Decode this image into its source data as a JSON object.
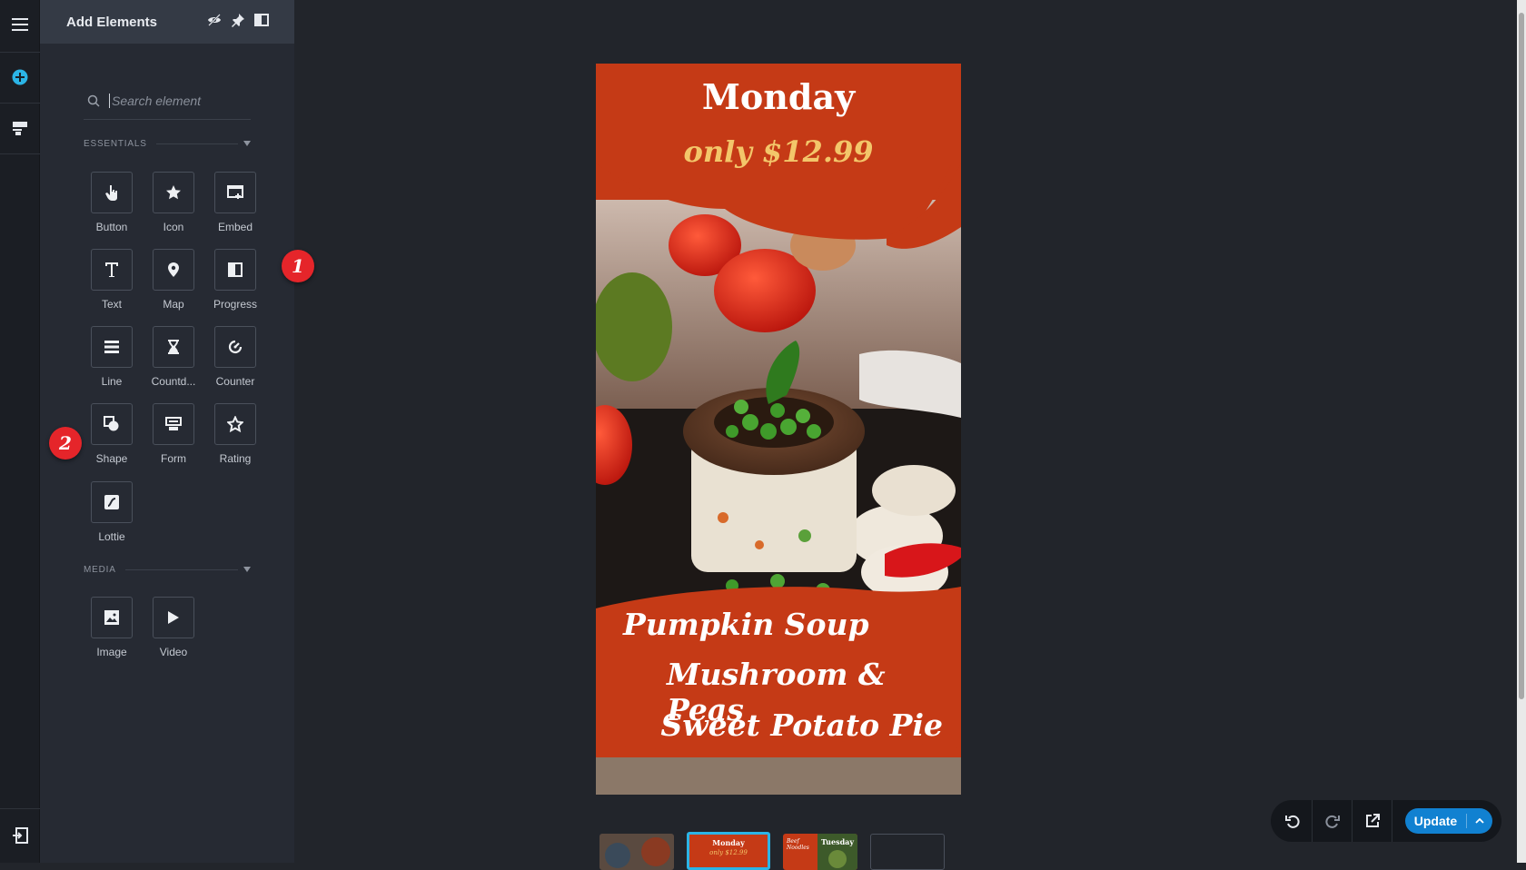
{
  "panel": {
    "title": "Add Elements",
    "search_placeholder": "Search element",
    "sections": {
      "essentials": "ESSENTIALS",
      "media": "MEDIA"
    },
    "essentials": [
      {
        "label": "Button",
        "icon": "hand-pointer-icon"
      },
      {
        "label": "Icon",
        "icon": "star-icon"
      },
      {
        "label": "Embed",
        "icon": "embed-icon"
      },
      {
        "label": "Text",
        "icon": "text-icon"
      },
      {
        "label": "Map",
        "icon": "map-pin-icon"
      },
      {
        "label": "Progress",
        "icon": "progress-icon"
      },
      {
        "label": "Line",
        "icon": "line-icon"
      },
      {
        "label": "Countd...",
        "icon": "hourglass-icon"
      },
      {
        "label": "Counter",
        "icon": "counter-icon"
      },
      {
        "label": "Shape",
        "icon": "shape-icon"
      },
      {
        "label": "Form",
        "icon": "form-icon"
      },
      {
        "label": "Rating",
        "icon": "rating-star-icon"
      },
      {
        "label": "Lottie",
        "icon": "lottie-icon"
      }
    ],
    "media": [
      {
        "label": "Image",
        "icon": "image-icon"
      },
      {
        "label": "Video",
        "icon": "play-icon"
      }
    ]
  },
  "badges": [
    "1",
    "2"
  ],
  "story": {
    "heading": "Monday",
    "price": "only $12.99",
    "items": [
      "Pumpkin Soup",
      "Mushroom & Peas",
      "Sweet Potato Pie"
    ]
  },
  "thumbnails": [
    {
      "title": "",
      "subtitle": ""
    },
    {
      "title": "Monday",
      "subtitle": "only $12.99"
    },
    {
      "title": "Tuesday",
      "subtitle": "Beef Noodles"
    },
    {
      "title": "",
      "subtitle": ""
    }
  ],
  "toolbar": {
    "update_label": "Update"
  },
  "colors": {
    "accent": "#1181d1",
    "story_bg": "#c53a16",
    "price": "#f3c66a",
    "badge": "#e5252a"
  }
}
